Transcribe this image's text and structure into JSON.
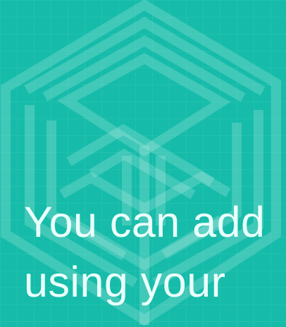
{
  "slide": {
    "background_color": "#16bca9",
    "logo_icon": "cube-logo-icon",
    "text_lines": [
      "You can add",
      "using  your"
    ]
  }
}
